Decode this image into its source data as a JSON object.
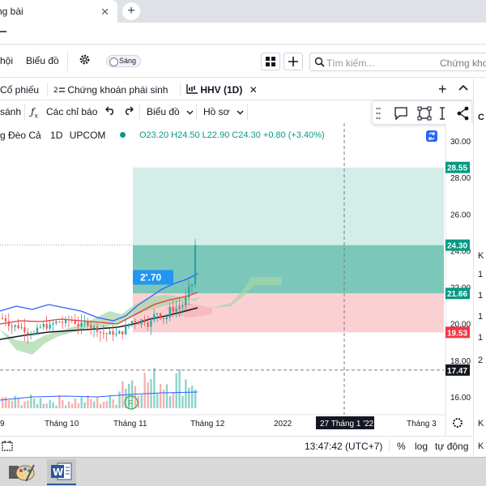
{
  "browser": {
    "tab_title": "ng bài",
    "close_glyph": "✕",
    "new_tab_glyph": "+"
  },
  "topbar": {
    "menu1": "hội",
    "menu2": "Biểu đồ",
    "theme_toggle": "Sáng",
    "search_placeholder": "Tìm kiếm...",
    "search_context": "Chứng khoá"
  },
  "tabs": [
    {
      "label": "Cổ phiếu"
    },
    {
      "label": "Chứng khoán phái sinh"
    },
    {
      "label": "HHV (1D)",
      "active": true
    }
  ],
  "add_tab_glyph": "+",
  "toolbar": {
    "compare": "sánh",
    "indicators": "Các chỉ báo",
    "chart_menu": "Biểu đồ",
    "profile_menu": "Hồ sơ"
  },
  "legend": {
    "symbol_name": "g Đèo Cả",
    "interval": "1D",
    "exchange": "UPCOM",
    "ohlc": "O23.20  H24.50  L22.90  C24.30  +0.80 (+3.40%)"
  },
  "chart_data": {
    "type": "candlestick",
    "symbol": "HHV",
    "interval": "1D",
    "exchange": "UPCOM",
    "ohlc_last": {
      "open": 23.2,
      "high": 24.5,
      "low": 22.9,
      "close": 24.3,
      "change": 0.8,
      "change_pct": 3.4
    },
    "y_ticks": [
      30.0,
      28.0,
      26.0,
      24.0,
      22.0,
      20.0,
      18.0,
      16.0
    ],
    "ylim": [
      15.2,
      31.0
    ],
    "x_ticks": [
      "9",
      "Tháng 10",
      "Tháng 11",
      "Tháng 12",
      "2022",
      "27 Tháng 1 '22",
      "Tháng 3"
    ],
    "price_labels": [
      {
        "value": 28.55,
        "text": "28.55",
        "color": "#089981"
      },
      {
        "value": 24.3,
        "text": "24.30",
        "color": "#089981"
      },
      {
        "value": 21.66,
        "text": "21.66",
        "color": "#089981"
      },
      {
        "value": 19.53,
        "text": "19.53",
        "color": "#f23645"
      },
      {
        "value": 17.47,
        "text": "17.47",
        "color": "#131722"
      }
    ],
    "position_tool": {
      "target": 28.55,
      "entry": 24.3,
      "entry_zone_bottom": 21.66,
      "stop": 19.53
    },
    "crosshair": {
      "price": 17.47,
      "date": "27 Tháng 1 '22"
    },
    "badge": {
      "text": "2'.70",
      "value": 21.7
    },
    "marker": "F"
  },
  "status": {
    "time": "13:47:42 (UTC+7)",
    "percent": "%",
    "log": "log",
    "auto": "tự động"
  },
  "colors": {
    "up": "#26a69a",
    "down": "#ef5350",
    "profit_zone": "#b2dfdb",
    "loss_zone": "#fccbcd",
    "accent": "#2962ff"
  }
}
